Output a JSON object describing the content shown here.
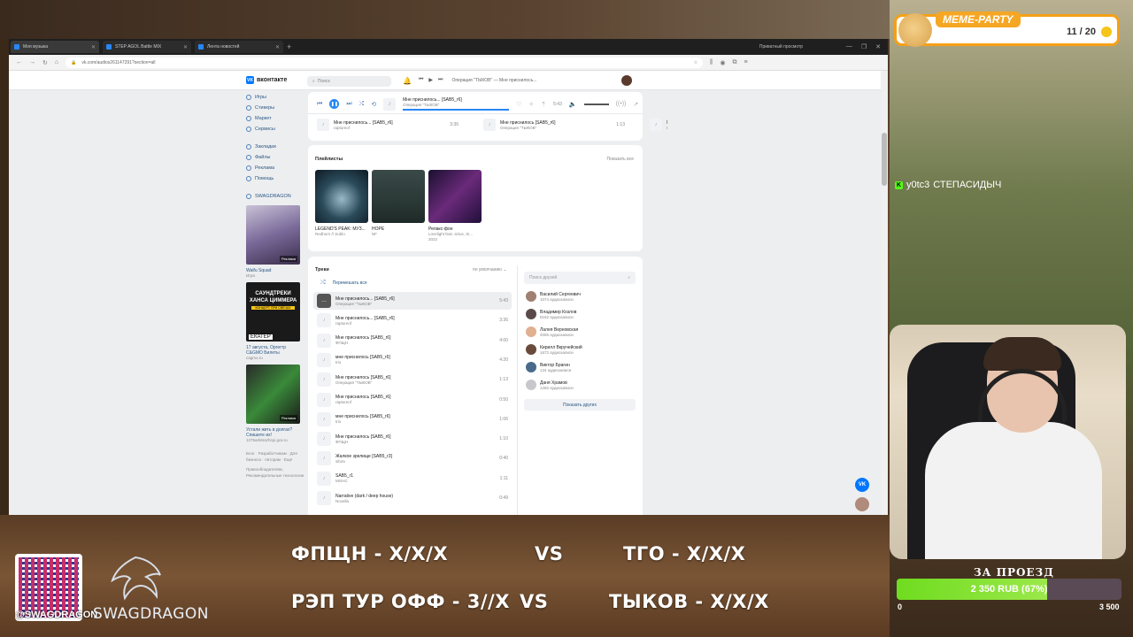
{
  "browser": {
    "tabs": [
      {
        "label": "Моя музыка",
        "active": true
      },
      {
        "label": "STEP AGOL Battle MIX",
        "active": false
      },
      {
        "label": "Лента новостей",
        "active": false
      }
    ],
    "right_tab": "Приватный просмотр",
    "url": "vk.com/audios261147291?section=all"
  },
  "vk": {
    "logo": "вконтакте",
    "search_placeholder": "Поиск",
    "mini_player": {
      "title": "Операция \"ТЫКОВ\" — Мне приснилось..."
    },
    "player": {
      "title": "Мне приснилось... [SAB5_r6]",
      "artist": "Операция \"ТЫКОВ\"",
      "time": "5:43"
    },
    "nav": [
      "Игры",
      "Стикеры",
      "Маркет",
      "Сервисы"
    ],
    "nav2": [
      "Закладки",
      "Файлы",
      "Реклама",
      "Помощь"
    ],
    "group": "SWAGDRAGON",
    "ads": [
      {
        "title": "Waifu Squad",
        "sub": "Игра",
        "badge": "Реклама"
      },
      {
        "title": "17 августа, Оргегтр C&GMO Билеты",
        "sub": "cagmo.ru",
        "line1": "САУНДТРЕКИ",
        "line2": "ХАНСА ЦИММЕРА",
        "line3": "КОНЦЕРТ ПРИ СВЕЧАХ",
        "corner": "ЕКАТЕР"
      },
      {
        "title": "Устали жить в долгах? Спишите их!",
        "sub": "1275arbitrazhnyi.gov.ru",
        "badge": "Реклама"
      }
    ],
    "footer": [
      "Блог",
      "Разработчикам",
      "Для бизнеса",
      "Авторам",
      "Ещё"
    ],
    "footer2": "Правообладателям, Рекомендательные технологии",
    "recent_tracks": [
      {
        "title": "Мне приснилось... [SAB5_r6]",
        "artist": "raptureof",
        "duration": "3:36"
      },
      {
        "title": "Мне приснилось [SAB5_r6]",
        "artist": "Операция \"ТЫКОВ\"",
        "duration": "1:13"
      },
      {
        "title": "Мн",
        "artist": "Le",
        "duration": ""
      }
    ],
    "playlists": {
      "title": "Плейлисты",
      "show_all": "Показать все",
      "items": [
        {
          "name": "LEGEND'S PEAK: МУЗ...",
          "sub": "Redhorn // Sublo"
        },
        {
          "name": "HOPE",
          "sub": "NF"
        },
        {
          "name": "Релакс-фон",
          "sub": "Lovelight feat. sirius, Si...",
          "year": "2022"
        }
      ]
    },
    "tracks": {
      "title": "Треки",
      "sort": "по умолчанию",
      "shuffle": "Перемешать все",
      "items": [
        {
          "title": "Мне приснилось... [SAB5_r6]",
          "artist": "Операция \"ТЫКОВ\"",
          "duration": "5:43",
          "current": true
        },
        {
          "title": "Мне приснилось... [SAB5_r6]",
          "artist": "raptureof",
          "duration": "3:36"
        },
        {
          "title": "Мне приснилось [SAB5_r6]",
          "artist": "ФПЩН",
          "duration": "4:00"
        },
        {
          "title": "мне приснилось [SAB5_r6]",
          "artist": "trio",
          "duration": "4:20"
        },
        {
          "title": "Мне приснилось [SAB5_r6]",
          "artist": "Операция \"ТЫКОВ\"",
          "duration": "1:13"
        },
        {
          "title": "Мне приснилось [SAB5_r6]",
          "artist": "raptureof",
          "duration": "0:50"
        },
        {
          "title": "мне приснилось [SAB5_r6]",
          "artist": "trio",
          "duration": "1:06"
        },
        {
          "title": "Мне приснилось [SAB5_r6]",
          "artist": "ФПЩН",
          "duration": "1:10"
        },
        {
          "title": "Жалкое зрелище [SAB5_r3]",
          "artist": "sibira",
          "duration": "0:40"
        },
        {
          "title": "SAB5_r1",
          "artist": "MGHC",
          "duration": "1:11"
        },
        {
          "title": "Narrative (dark / deep house)",
          "artist": "Novella",
          "duration": "0:49"
        }
      ]
    },
    "friends": {
      "search_placeholder": "Поиск друзей",
      "items": [
        {
          "name": "Василий Сергеевич",
          "count": "1074 аудиозаписи"
        },
        {
          "name": "Владимир Козлов",
          "count": "8162 аудиозаписи"
        },
        {
          "name": "Лалея Верновская",
          "count": "4055 аудиозаписи"
        },
        {
          "name": "Кирилл Вкручейский",
          "count": "1672 аудиозаписи"
        },
        {
          "name": "Виктор Брагин",
          "count": "134 аудиозаписи"
        },
        {
          "name": "Даня Храмов",
          "count": "1282 аудиозаписи"
        }
      ],
      "show_more": "Показать других"
    }
  },
  "overlay": {
    "meme_title": "MEME-PARTY",
    "meme_count": "11 / 20",
    "chat": {
      "user": "y0tc3",
      "message": "СТЕПАСИДЫЧ"
    },
    "goal": {
      "title": "ЗА ПРОЕЗД",
      "label": "2 350 RUB (67%)",
      "progress": 0.67,
      "min": "0",
      "max": "3 500"
    },
    "handle": "@SWAGDRAGON",
    "brand": "SWAGDRAGON",
    "scores": [
      {
        "left": "ФПЩН - X/X/X",
        "vs": "VS",
        "right": "ТГО - X/X/X"
      },
      {
        "left": "РЭП ТУР ОФФ - 3//X",
        "vs": "VS",
        "right": "ТЫКОВ - X/X/X"
      }
    ]
  },
  "colors": {
    "vk_blue": "#0077ff",
    "link": "#2a5885",
    "goal_fill": "#6fdc1f",
    "meme_orange": "#f5a623"
  }
}
